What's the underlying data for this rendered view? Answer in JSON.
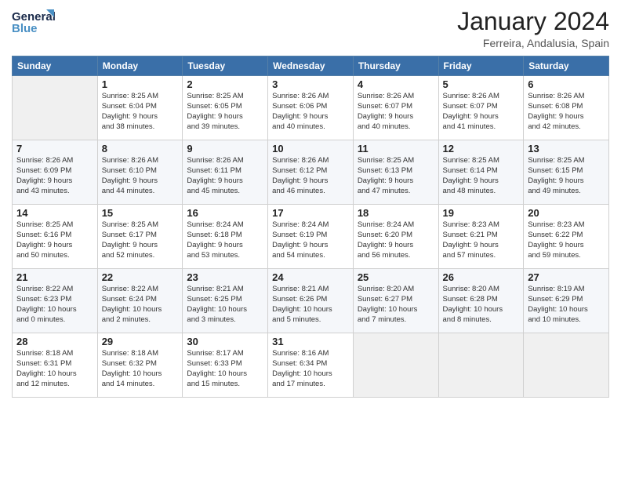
{
  "header": {
    "logo_line1": "General",
    "logo_line2": "Blue",
    "month_year": "January 2024",
    "location": "Ferreira, Andalusia, Spain"
  },
  "weekdays": [
    "Sunday",
    "Monday",
    "Tuesday",
    "Wednesday",
    "Thursday",
    "Friday",
    "Saturday"
  ],
  "weeks": [
    [
      {
        "day": "",
        "info": ""
      },
      {
        "day": "1",
        "info": "Sunrise: 8:25 AM\nSunset: 6:04 PM\nDaylight: 9 hours\nand 38 minutes."
      },
      {
        "day": "2",
        "info": "Sunrise: 8:25 AM\nSunset: 6:05 PM\nDaylight: 9 hours\nand 39 minutes."
      },
      {
        "day": "3",
        "info": "Sunrise: 8:26 AM\nSunset: 6:06 PM\nDaylight: 9 hours\nand 40 minutes."
      },
      {
        "day": "4",
        "info": "Sunrise: 8:26 AM\nSunset: 6:07 PM\nDaylight: 9 hours\nand 40 minutes."
      },
      {
        "day": "5",
        "info": "Sunrise: 8:26 AM\nSunset: 6:07 PM\nDaylight: 9 hours\nand 41 minutes."
      },
      {
        "day": "6",
        "info": "Sunrise: 8:26 AM\nSunset: 6:08 PM\nDaylight: 9 hours\nand 42 minutes."
      }
    ],
    [
      {
        "day": "7",
        "info": ""
      },
      {
        "day": "8",
        "info": "Sunrise: 8:26 AM\nSunset: 6:10 PM\nDaylight: 9 hours\nand 44 minutes."
      },
      {
        "day": "9",
        "info": "Sunrise: 8:26 AM\nSunset: 6:11 PM\nDaylight: 9 hours\nand 45 minutes."
      },
      {
        "day": "10",
        "info": "Sunrise: 8:26 AM\nSunset: 6:12 PM\nDaylight: 9 hours\nand 46 minutes."
      },
      {
        "day": "11",
        "info": "Sunrise: 8:25 AM\nSunset: 6:13 PM\nDaylight: 9 hours\nand 47 minutes."
      },
      {
        "day": "12",
        "info": "Sunrise: 8:25 AM\nSunset: 6:14 PM\nDaylight: 9 hours\nand 48 minutes."
      },
      {
        "day": "13",
        "info": "Sunrise: 8:25 AM\nSunset: 6:15 PM\nDaylight: 9 hours\nand 49 minutes."
      }
    ],
    [
      {
        "day": "14",
        "info": ""
      },
      {
        "day": "15",
        "info": "Sunrise: 8:25 AM\nSunset: 6:17 PM\nDaylight: 9 hours\nand 52 minutes."
      },
      {
        "day": "16",
        "info": "Sunrise: 8:24 AM\nSunset: 6:18 PM\nDaylight: 9 hours\nand 53 minutes."
      },
      {
        "day": "17",
        "info": "Sunrise: 8:24 AM\nSunset: 6:19 PM\nDaylight: 9 hours\nand 54 minutes."
      },
      {
        "day": "18",
        "info": "Sunrise: 8:24 AM\nSunset: 6:20 PM\nDaylight: 9 hours\nand 56 minutes."
      },
      {
        "day": "19",
        "info": "Sunrise: 8:23 AM\nSunset: 6:21 PM\nDaylight: 9 hours\nand 57 minutes."
      },
      {
        "day": "20",
        "info": "Sunrise: 8:23 AM\nSunset: 6:22 PM\nDaylight: 9 hours\nand 59 minutes."
      }
    ],
    [
      {
        "day": "21",
        "info": ""
      },
      {
        "day": "22",
        "info": "Sunrise: 8:22 AM\nSunset: 6:24 PM\nDaylight: 10 hours\nand 2 minutes."
      },
      {
        "day": "23",
        "info": "Sunrise: 8:21 AM\nSunset: 6:25 PM\nDaylight: 10 hours\nand 3 minutes."
      },
      {
        "day": "24",
        "info": "Sunrise: 8:21 AM\nSunset: 6:26 PM\nDaylight: 10 hours\nand 5 minutes."
      },
      {
        "day": "25",
        "info": "Sunrise: 8:20 AM\nSunset: 6:27 PM\nDaylight: 10 hours\nand 7 minutes."
      },
      {
        "day": "26",
        "info": "Sunrise: 8:20 AM\nSunset: 6:28 PM\nDaylight: 10 hours\nand 8 minutes."
      },
      {
        "day": "27",
        "info": "Sunrise: 8:19 AM\nSunset: 6:29 PM\nDaylight: 10 hours\nand 10 minutes."
      }
    ],
    [
      {
        "day": "28",
        "info": ""
      },
      {
        "day": "29",
        "info": "Sunrise: 8:18 AM\nSunset: 6:32 PM\nDaylight: 10 hours\nand 14 minutes."
      },
      {
        "day": "30",
        "info": "Sunrise: 8:17 AM\nSunset: 6:33 PM\nDaylight: 10 hours\nand 15 minutes."
      },
      {
        "day": "31",
        "info": "Sunrise: 8:16 AM\nSunset: 6:34 PM\nDaylight: 10 hours\nand 17 minutes."
      },
      {
        "day": "",
        "info": ""
      },
      {
        "day": "",
        "info": ""
      },
      {
        "day": "",
        "info": ""
      }
    ]
  ],
  "week1_day7_info": "Sunrise: 8:26 AM\nSunset: 6:09 PM\nDaylight: 9 hours\nand 43 minutes.",
  "week2_day14_info": "Sunrise: 8:25 AM\nSunset: 6:16 PM\nDaylight: 9 hours\nand 50 minutes.",
  "week3_day21_info": "Sunrise: 8:22 AM\nSunset: 6:23 PM\nDaylight: 10 hours\nand 0 minutes.",
  "week4_day28_info": "Sunrise: 8:18 AM\nSunset: 6:31 PM\nDaylight: 10 hours\nand 12 minutes."
}
